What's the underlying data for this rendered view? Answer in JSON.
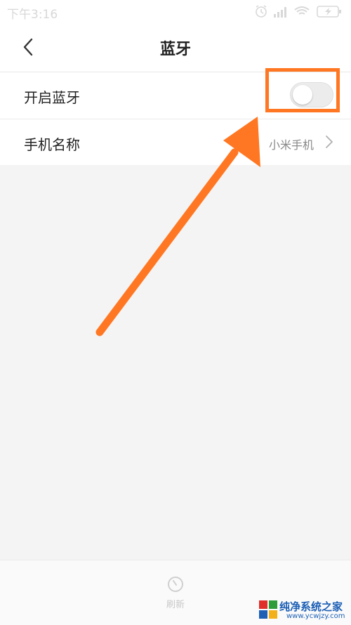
{
  "status": {
    "time": "下午3:16",
    "signal_icon": "signal-icon",
    "wifi_icon": "wifi-icon",
    "battery_icon": "battery-icon",
    "alarm_icon": "alarm-icon"
  },
  "header": {
    "title": "蓝牙",
    "back_icon": "chevron-left-icon"
  },
  "settings": {
    "bluetooth_label": "开启蓝牙",
    "bluetooth_enabled": false,
    "device_name_label": "手机名称",
    "device_name_value": "小米手机"
  },
  "bottom": {
    "refresh_label": "刷新"
  },
  "watermark": {
    "name": "纯净系统之家",
    "url": "www.ycwjzy.com"
  },
  "colors": {
    "highlight": "#ff7722",
    "background": "#f4f4f4"
  }
}
